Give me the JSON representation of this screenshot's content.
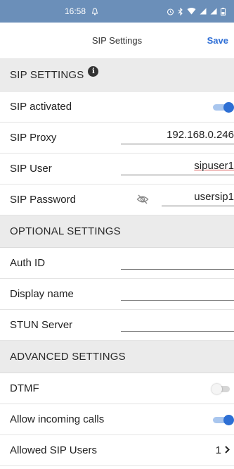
{
  "statusbar": {
    "time": "16:58"
  },
  "navbar": {
    "title": "SIP Settings",
    "save_label": "Save"
  },
  "sections": {
    "sip": "SIP SETTINGS",
    "optional": "OPTIONAL SETTINGS",
    "advanced": "ADVANCED SETTINGS"
  },
  "sip": {
    "activated": {
      "label": "SIP activated",
      "value": true
    },
    "proxy": {
      "label": "SIP Proxy",
      "value": "192.168.0.246"
    },
    "user": {
      "label": "SIP User",
      "value": "sipuser1"
    },
    "password": {
      "label": "SIP Password",
      "value": "usersip1"
    }
  },
  "optional": {
    "auth_id": {
      "label": "Auth ID",
      "value": ""
    },
    "display_name": {
      "label": "Display name",
      "value": ""
    },
    "stun_server": {
      "label": "STUN Server",
      "value": ""
    }
  },
  "advanced": {
    "dtmf": {
      "label": "DTMF",
      "value": false
    },
    "allow_incoming": {
      "label": "Allow incoming calls",
      "value": true
    },
    "allowed_users": {
      "label": "Allowed SIP Users",
      "count": "1"
    }
  },
  "icons": [
    "alarm-icon",
    "bluetooth-icon",
    "wifi-icon",
    "signal-icon",
    "battery-icon",
    "info-icon",
    "eye-off-icon",
    "chevron-right-icon"
  ],
  "colors": {
    "statusbar": "#6b8fb9",
    "accent": "#2d6fd4",
    "section_bg": "#ebebeb"
  }
}
